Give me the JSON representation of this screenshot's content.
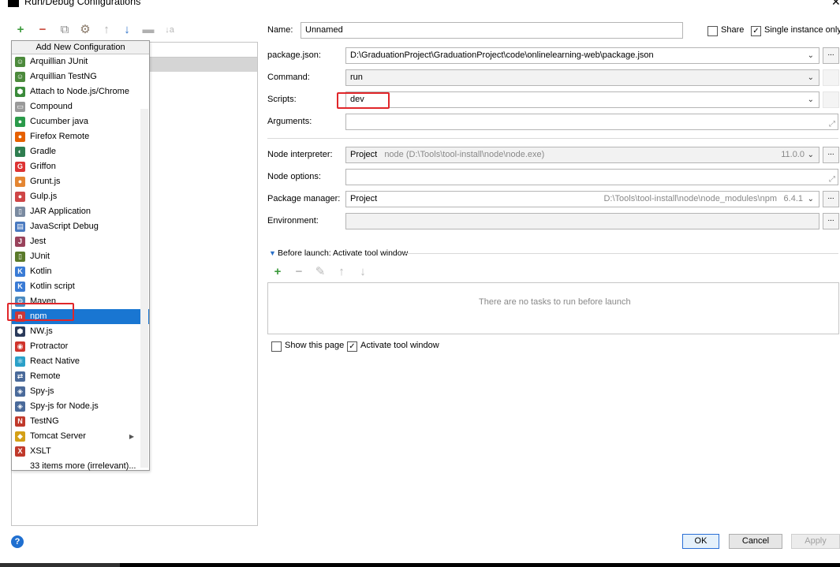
{
  "window": {
    "title": "Run/Debug Configurations"
  },
  "popup": {
    "header": "Add New Configuration",
    "items": [
      {
        "label": "Arquillian JUnit",
        "icon": "arquillian-icon",
        "color": "#4c8a3c"
      },
      {
        "label": "Arquillian TestNG",
        "icon": "arquillian-icon",
        "color": "#4c8a3c"
      },
      {
        "label": "Attach to Node.js/Chrome",
        "icon": "attach-node-icon",
        "color": "#3a8a3a"
      },
      {
        "label": "Compound",
        "icon": "compound-icon",
        "color": "#9a9a9a"
      },
      {
        "label": "Cucumber java",
        "icon": "cucumber-icon",
        "color": "#2a9a4a"
      },
      {
        "label": "Firefox Remote",
        "icon": "firefox-icon",
        "color": "#e66000"
      },
      {
        "label": "Gradle",
        "icon": "gradle-icon",
        "color": "#2e7d4f"
      },
      {
        "label": "Griffon",
        "icon": "griffon-icon",
        "color": "#d33"
      },
      {
        "label": "Grunt.js",
        "icon": "grunt-icon",
        "color": "#e48632"
      },
      {
        "label": "Gulp.js",
        "icon": "gulp-icon",
        "color": "#cf4647"
      },
      {
        "label": "JAR Application",
        "icon": "jar-icon",
        "color": "#7a8aa0"
      },
      {
        "label": "JavaScript Debug",
        "icon": "js-debug-icon",
        "color": "#4a7ac0"
      },
      {
        "label": "Jest",
        "icon": "jest-icon",
        "color": "#99425b"
      },
      {
        "label": "JUnit",
        "icon": "junit-icon",
        "color": "#5a7a2a"
      },
      {
        "label": "Kotlin",
        "icon": "kotlin-icon",
        "color": "#3a7bd5"
      },
      {
        "label": "Kotlin script",
        "icon": "kotlin-script-icon",
        "color": "#3a7bd5"
      },
      {
        "label": "Maven",
        "icon": "maven-icon",
        "color": "#4a8ac0"
      },
      {
        "label": "npm",
        "icon": "npm-icon",
        "color": "#cb3837",
        "selected": true
      },
      {
        "label": "NW.js",
        "icon": "nwjs-icon",
        "color": "#2a3a5a"
      },
      {
        "label": "Protractor",
        "icon": "protractor-icon",
        "color": "#d0342c"
      },
      {
        "label": "React Native",
        "icon": "react-icon",
        "color": "#2aa0c8"
      },
      {
        "label": "Remote",
        "icon": "remote-icon",
        "color": "#4a6a9a"
      },
      {
        "label": "Spy-js",
        "icon": "spy-js-icon",
        "color": "#4a6a9a"
      },
      {
        "label": "Spy-js for Node.js",
        "icon": "spy-js-node-icon",
        "color": "#4a6a9a"
      },
      {
        "label": "TestNG",
        "icon": "testng-icon",
        "color": "#c0392b"
      },
      {
        "label": "Tomcat Server",
        "icon": "tomcat-icon",
        "color": "#d4a017",
        "submenu": true
      },
      {
        "label": "XSLT",
        "icon": "xslt-icon",
        "color": "#c0392b"
      },
      {
        "label": "33 items more (irrelevant)...",
        "icon": "",
        "color": ""
      }
    ]
  },
  "form": {
    "name_label": "Name:",
    "name_value": "Unnamed",
    "share_label": "Share",
    "share_checked": false,
    "single_instance_label": "Single instance only",
    "single_instance_checked": true,
    "package_json_label": "package.json:",
    "package_json_value": "D:\\GraduationProject\\GraduationProject\\code\\onlinelearning-web\\package.json",
    "command_label": "Command:",
    "command_value": "run",
    "scripts_label": "Scripts:",
    "scripts_value": "dev",
    "arguments_label": "Arguments:",
    "arguments_value": "",
    "node_interpreter_label": "Node interpreter:",
    "node_interpreter_value": "Project",
    "node_interpreter_path": "node (D:\\Tools\\tool-install\\node\\node.exe)",
    "node_interpreter_version": "11.0.0",
    "node_options_label": "Node options:",
    "node_options_value": "",
    "package_manager_label": "Package manager:",
    "package_manager_value": "Project",
    "package_manager_path": "D:\\Tools\\tool-install\\node\\node_modules\\npm",
    "package_manager_version": "6.4.1",
    "environment_label": "Environment:",
    "environment_value": "",
    "browse_label": "...",
    "before_launch_label": "Before launch: Activate tool window",
    "no_tasks_text": "There are no tasks to run before launch",
    "show_page_label": "Show this page",
    "show_page_checked": false,
    "activate_tool_label": "Activate tool window",
    "activate_tool_checked": true
  },
  "buttons": {
    "ok": "OK",
    "cancel": "Cancel",
    "apply": "Apply"
  },
  "help": {
    "label": "?"
  },
  "colors": {
    "selection": "#1976d2",
    "highlight_box": "#e0262a",
    "add_green": "#3c9a3c",
    "remove_red": "#c94a3c"
  }
}
